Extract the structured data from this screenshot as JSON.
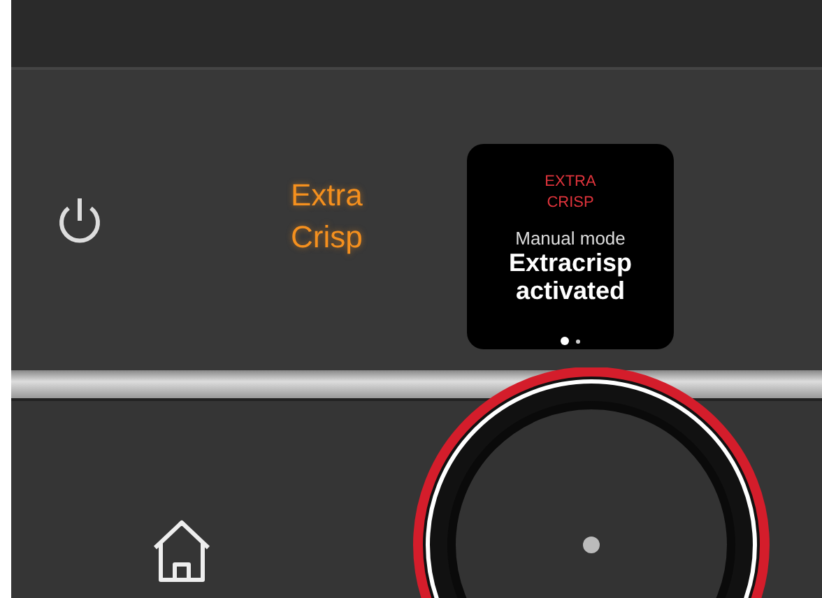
{
  "mode_label": "Extra Crisp",
  "display": {
    "title": "EXTRA CRISP",
    "subtitle": "Manual mode",
    "message": "Extracrisp activated",
    "pages": [
      {
        "selected": true
      },
      {
        "selected": false
      }
    ]
  }
}
